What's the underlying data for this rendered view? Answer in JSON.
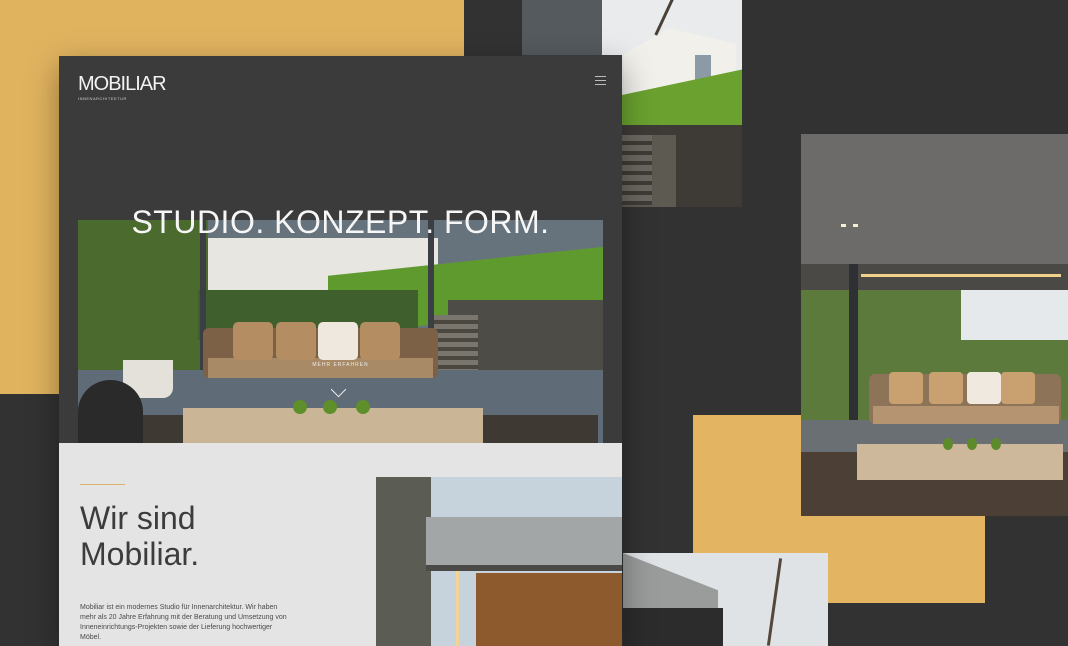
{
  "brand": {
    "name": "MOBILIAR",
    "tagline": "INNENARCHITEKTUR"
  },
  "hero": {
    "headline": "STUDIO. KONZEPT. FORM.",
    "more_label": "MEHR ERFAHREN"
  },
  "about": {
    "heading": "Wir sind Mobiliar.",
    "body": "Mobiliar ist ein modernes Studio für Innenarchitektur. Wir haben mehr als 20 Jahre Erfahrung mit der Beratung und Umsetzung von Inneneinrichtungs-Projekten sowie der Lieferung hochwertiger Möbel."
  },
  "colors": {
    "accent_gold": "#e0b35f",
    "background_dark": "#333232",
    "site_dark": "#3c3b3b",
    "section_light": "#e4e4e4"
  },
  "icons": {
    "menu": "hamburger-menu-icon",
    "scroll_down": "chevron-down-icon"
  }
}
